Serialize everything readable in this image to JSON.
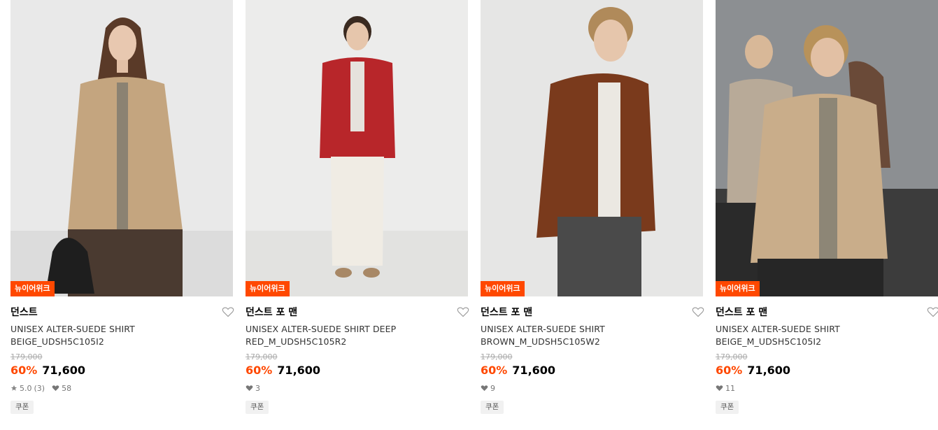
{
  "products": [
    {
      "badge": "뉴이어위크",
      "brand": "던스트",
      "name_line1": "UNISEX ALTER-SUEDE SHIRT",
      "name_line2": "BEIGE_UDSH5C105I2",
      "original_price": "179,000",
      "discount": "60%",
      "price": "71,600",
      "rating": "5.0",
      "review_count": "(3)",
      "likes": "58",
      "coupon": "쿠폰",
      "photo_desc": "model-beige-suede-shirt",
      "shirt_color": "#c4a57f",
      "bg_color": "#e9e9e9"
    },
    {
      "badge": "뉴이어위크",
      "brand": "던스트 포 맨",
      "name_line1": "UNISEX ALTER-SUEDE SHIRT DEEP",
      "name_line2": "RED_M_UDSH5C105R2",
      "original_price": "179,000",
      "discount": "60%",
      "price": "71,600",
      "likes": "3",
      "coupon": "쿠폰",
      "photo_desc": "model-red-suede-shirt",
      "shirt_color": "#b8262a",
      "bg_color": "#ececeb"
    },
    {
      "badge": "뉴이어위크",
      "brand": "던스트 포 맨",
      "name_line1": "UNISEX ALTER-SUEDE SHIRT",
      "name_line2": "BROWN_M_UDSH5C105W2",
      "original_price": "179,000",
      "discount": "60%",
      "price": "71,600",
      "likes": "9",
      "coupon": "쿠폰",
      "photo_desc": "model-brown-suede-shirt",
      "shirt_color": "#7a3a1c",
      "bg_color": "#e6e6e5"
    },
    {
      "badge": "뉴이어위크",
      "brand": "던스트 포 맨",
      "name_line1": "UNISEX ALTER-SUEDE SHIRT",
      "name_line2": "BEIGE_M_UDSH5C105I2",
      "original_price": "179,000",
      "discount": "60%",
      "price": "71,600",
      "likes": "11",
      "coupon": "쿠폰",
      "photo_desc": "street-models-beige-suede-shirt",
      "shirt_color": "#c9ad8a",
      "bg_color": "#8c8f92"
    }
  ],
  "colors": {
    "accent": "#ff4800",
    "star": "#777777"
  }
}
